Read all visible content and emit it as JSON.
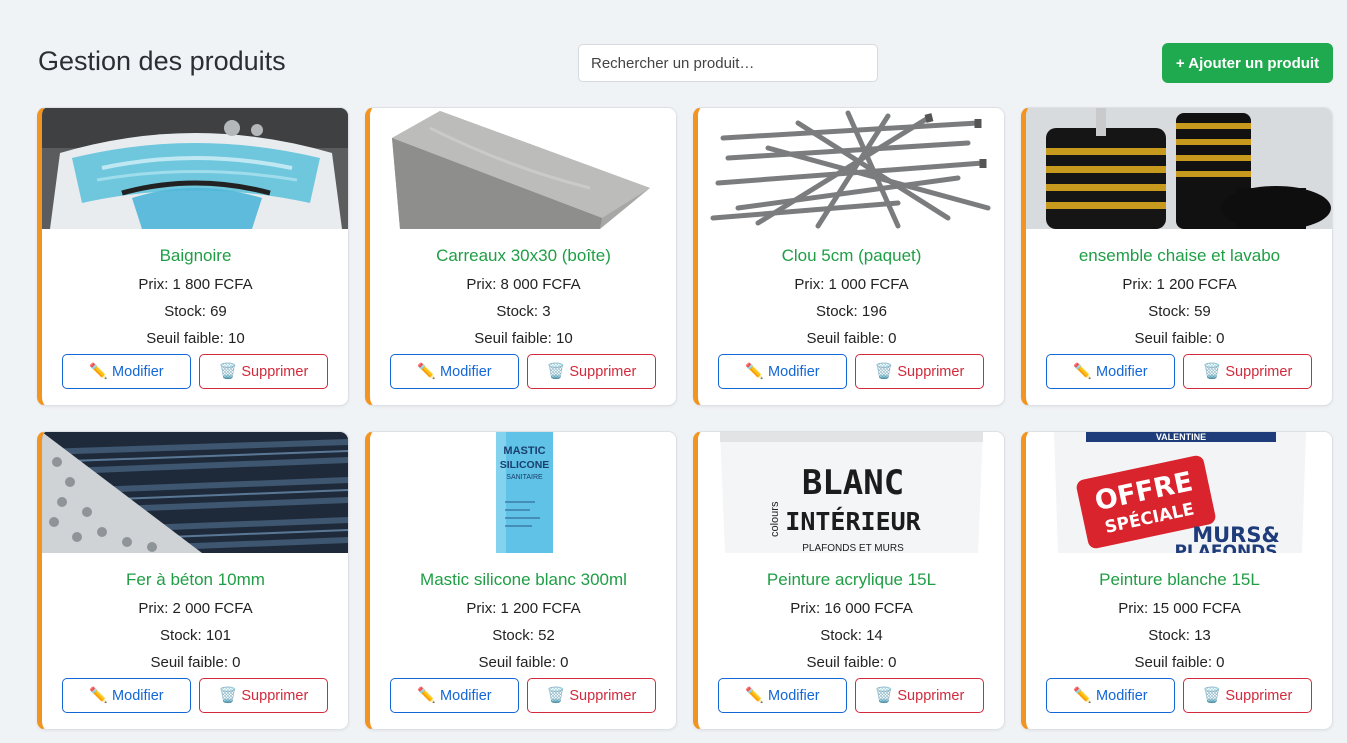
{
  "header": {
    "title": "Gestion des produits",
    "search_placeholder": "Rechercher un produit…",
    "add_button": "+ Ajouter un produit"
  },
  "colors": {
    "accent_orange": "#f29422",
    "product_name_green": "#1f9e45",
    "add_button_green": "#1faa4f",
    "edit_blue": "#1366d6",
    "delete_red": "#d02a3c"
  },
  "labels": {
    "edit": "Modifier",
    "delete": "Supprimer",
    "edit_icon": "pencil-icon",
    "delete_icon": "trash-icon"
  },
  "products": [
    {
      "name": "Baignoire",
      "price": "Prix: 1 800 FCFA",
      "stock": "Stock: 69",
      "threshold": "Seuil faible: 10",
      "image": "bathtub"
    },
    {
      "name": "Carreaux 30x30 (boîte)",
      "price": "Prix: 8 000 FCFA",
      "stock": "Stock: 3",
      "threshold": "Seuil faible: 10",
      "image": "tile"
    },
    {
      "name": "Clou 5cm (paquet)",
      "price": "Prix: 1 000 FCFA",
      "stock": "Stock: 196",
      "threshold": "Seuil faible: 0",
      "image": "nails"
    },
    {
      "name": "ensemble chaise et lavabo",
      "price": "Prix: 1 200 FCFA",
      "stock": "Stock: 59",
      "threshold": "Seuil faible: 0",
      "image": "toilet-set"
    },
    {
      "name": "Fer à béton 10mm",
      "price": "Prix: 2 000 FCFA",
      "stock": "Stock: 101",
      "threshold": "Seuil faible: 0",
      "image": "rebar"
    },
    {
      "name": "Mastic silicone blanc 300ml",
      "price": "Prix: 1 200 FCFA",
      "stock": "Stock: 52",
      "threshold": "Seuil faible: 0",
      "image": "silicone-tube"
    },
    {
      "name": "Peinture acrylique 15L",
      "price": "Prix: 16 000 FCFA",
      "stock": "Stock: 14",
      "threshold": "Seuil faible: 0",
      "image": "paint-bucket-blanc"
    },
    {
      "name": "Peinture blanche 15L",
      "price": "Prix: 15 000 FCFA",
      "stock": "Stock: 13",
      "threshold": "Seuil faible: 0",
      "image": "paint-bucket-offre"
    }
  ],
  "image_text": {
    "silicone": [
      "MASTIC",
      "SILICONE",
      "SANITAIRE"
    ],
    "blanc": [
      "colours",
      "BLANC",
      "INTÉRIEUR",
      "PLAFONDS ET MURS"
    ],
    "offre": [
      "VALENTINE",
      "OFFRE",
      "SPÉCIALE",
      "MURS&",
      "PLAFONDS"
    ]
  }
}
